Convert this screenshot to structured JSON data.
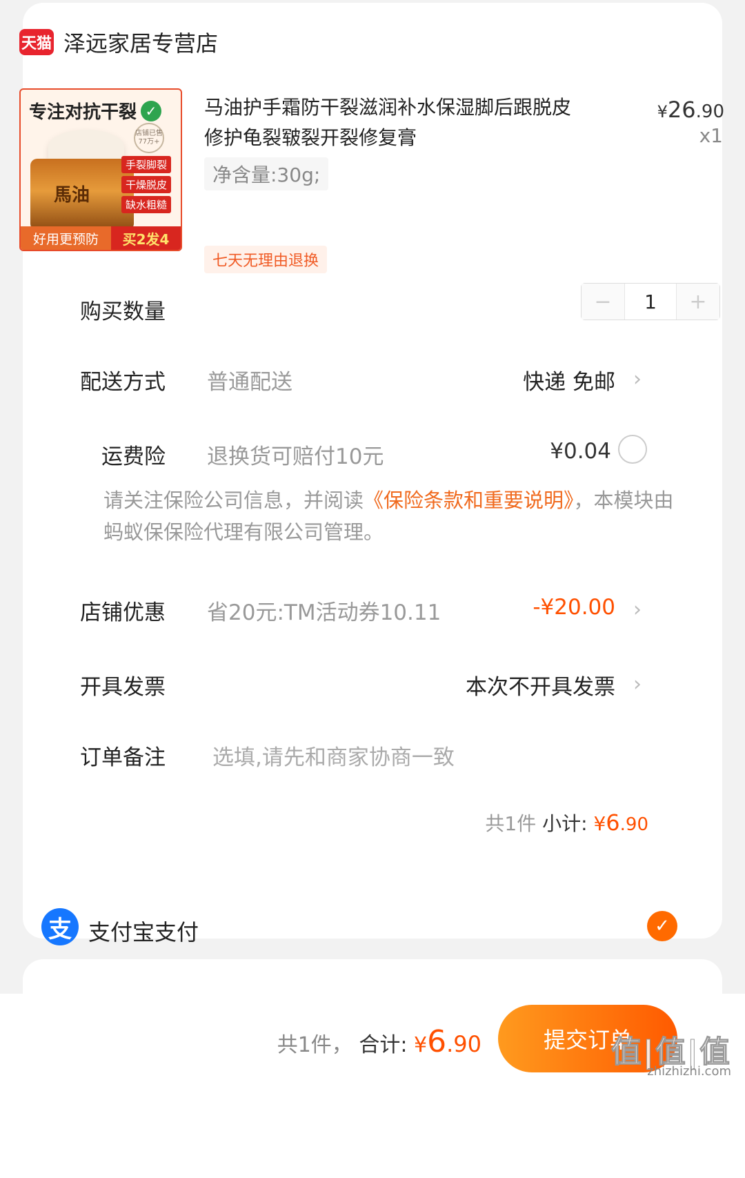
{
  "store": {
    "badge": "天猫",
    "name": "泽远家居专营店"
  },
  "product": {
    "image": {
      "headline": "专注对抗干裂",
      "seal": "店铺已售77万+",
      "jar_label": "馬油",
      "tags": [
        "手裂脚裂",
        "干燥脱皮",
        "缺水粗糙"
      ],
      "bottom_left": "好用更预防",
      "bottom_right": "买2发4"
    },
    "title": "马油护手霜防干裂滋润补水保湿脚后跟脱皮修护龟裂皲裂开裂修复膏",
    "price_symbol": "¥",
    "price_int": "26",
    "price_dec": ".90",
    "qty": "x1",
    "variant": "净含量:30g;",
    "return_tag": "七天无理由退换"
  },
  "quantity": {
    "label": "购买数量",
    "minus": "−",
    "plus": "+",
    "value": "1"
  },
  "delivery": {
    "label": "配送方式",
    "value": "普通配送",
    "right": "快递 免邮"
  },
  "insurance": {
    "label": "运费险",
    "value": "退换货可赔付10元",
    "right": "¥0.04",
    "note_prefix": "请关注保险公司信息，并阅读",
    "note_link": "《保险条款和重要说明》",
    "note_suffix": "，本模块由蚂蚁保保险代理有限公司管理。"
  },
  "discount": {
    "label": "店铺优惠",
    "value": "省20元:TM活动券10.11",
    "right": "-¥20.00"
  },
  "invoice": {
    "label": "开具发票",
    "right": "本次不开具发票"
  },
  "remark": {
    "label": "订单备注",
    "placeholder": "选填,请先和商家协商一致"
  },
  "subtotal": {
    "count": "共1件",
    "label": "小计:",
    "symbol": "¥",
    "int": "6",
    "dec": ".90"
  },
  "payment": {
    "label": "支付宝支付",
    "icon_char": "支"
  },
  "footer": {
    "count": "共1件，",
    "label": "合计:",
    "symbol": "¥",
    "int": "6",
    "dec": ".90",
    "submit": "提交订单",
    "watermark": "值|值|值",
    "watermark_sub": "zhizhizhi.com"
  },
  "colors": {
    "accent": "#ff5000",
    "tmall": "#e8242e",
    "alipay": "#1677ff",
    "link": "#f06a1e"
  }
}
